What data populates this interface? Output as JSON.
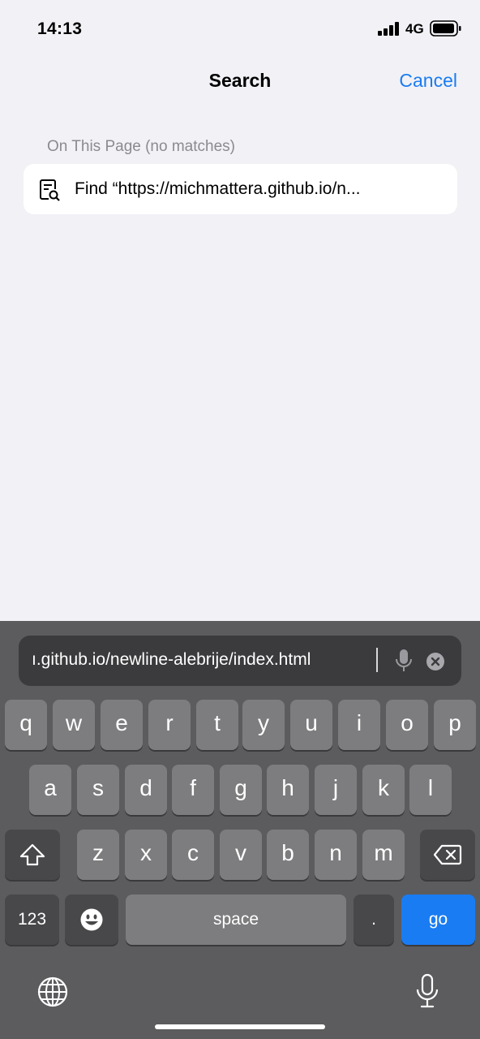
{
  "status_bar": {
    "time": "14:13",
    "network": "4G",
    "signal_icon": "cellular-signal-icon",
    "battery_icon": "battery-icon"
  },
  "nav": {
    "title": "Search",
    "cancel_label": "Cancel",
    "accent_color": "#1a7cf2"
  },
  "results": {
    "section_header": "On This Page (no matches)",
    "find_item": {
      "icon": "find-in-page-icon",
      "label": "Find “https://michmattera.github.io/n..."
    }
  },
  "keyboard": {
    "url_value": "https://michmattera.github.io/newline-alebrije/index.html",
    "url_visible": "ı.github.io/newline-alebrije/index.html",
    "row1": [
      "q",
      "w",
      "e",
      "r",
      "t",
      "y",
      "u",
      "i",
      "o",
      "p"
    ],
    "row2": [
      "a",
      "s",
      "d",
      "f",
      "g",
      "h",
      "j",
      "k",
      "l"
    ],
    "row3": [
      "z",
      "x",
      "c",
      "v",
      "b",
      "n",
      "m"
    ],
    "numbers_label": "123",
    "space_label": "space",
    "period_label": ".",
    "go_label": "go",
    "shift_icon": "shift-icon",
    "delete_icon": "backspace-icon",
    "emoji_icon": "emoji-icon",
    "globe_icon": "globe-icon",
    "dictation_icon": "microphone-icon"
  }
}
